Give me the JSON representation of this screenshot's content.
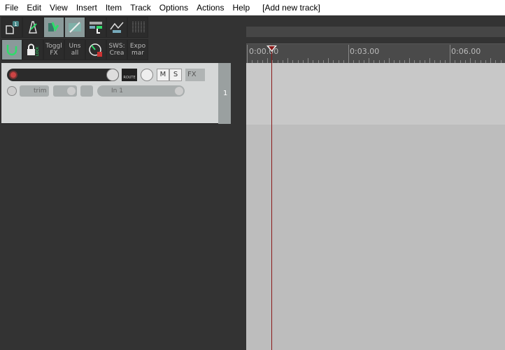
{
  "menu": [
    "File",
    "Edit",
    "View",
    "Insert",
    "Item",
    "Track",
    "Options",
    "Actions",
    "Help",
    "[Add new track]"
  ],
  "toolbar": {
    "row1": [
      {
        "icon": "new-project-icon",
        "badge": "1"
      },
      {
        "icon": "metronome-icon"
      },
      {
        "icon": "snap-icon",
        "active": true
      },
      {
        "icon": "ripple-edit-icon",
        "active": true
      },
      {
        "icon": "grid-icon"
      },
      {
        "icon": "envelope-icon"
      },
      {
        "icon": "mixer-icon"
      }
    ],
    "row2": [
      {
        "icon": "loop-icon",
        "active": true
      },
      {
        "icon": "lock-icon",
        "label": "LOCK"
      },
      {
        "label1": "Toggl",
        "label2": "FX"
      },
      {
        "label1": "Uns",
        "label2": "all"
      },
      {
        "icon": "record-timer-icon"
      },
      {
        "label1": "SWS:",
        "label2": "Crea"
      },
      {
        "label1": "Expo",
        "label2": "mar"
      }
    ]
  },
  "track": {
    "number": "1",
    "mute": "M",
    "solo": "S",
    "fx": "FX",
    "route": "ROUTE",
    "automation": "trim",
    "input": "In 1"
  },
  "ruler": {
    "labels": [
      "0:00.00",
      "0:03.00",
      "0:06.00"
    ]
  },
  "colors": {
    "playhead": "#8b1a1a",
    "accent": "#2fdc6a"
  }
}
